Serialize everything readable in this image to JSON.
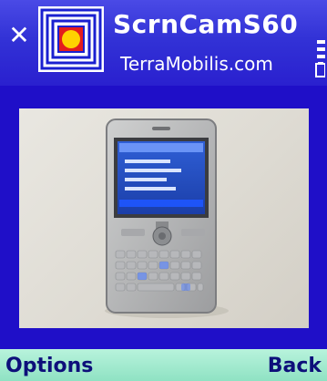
{
  "header": {
    "title": "ScrnCamS60",
    "subtitle": "TerraMobilis.com",
    "close_icon": "close-icon",
    "app_icon": "concentric-squares-icon"
  },
  "content": {
    "image": "photo of silver phone with QWERTY keyboard"
  },
  "softkeys": {
    "left_label": "Options",
    "right_label": "Back"
  },
  "colors": {
    "background": "#1f0fc8",
    "header": "#3a34da",
    "softkey_bar": "#a5ecd1",
    "softkey_text": "#0d0f7a"
  }
}
